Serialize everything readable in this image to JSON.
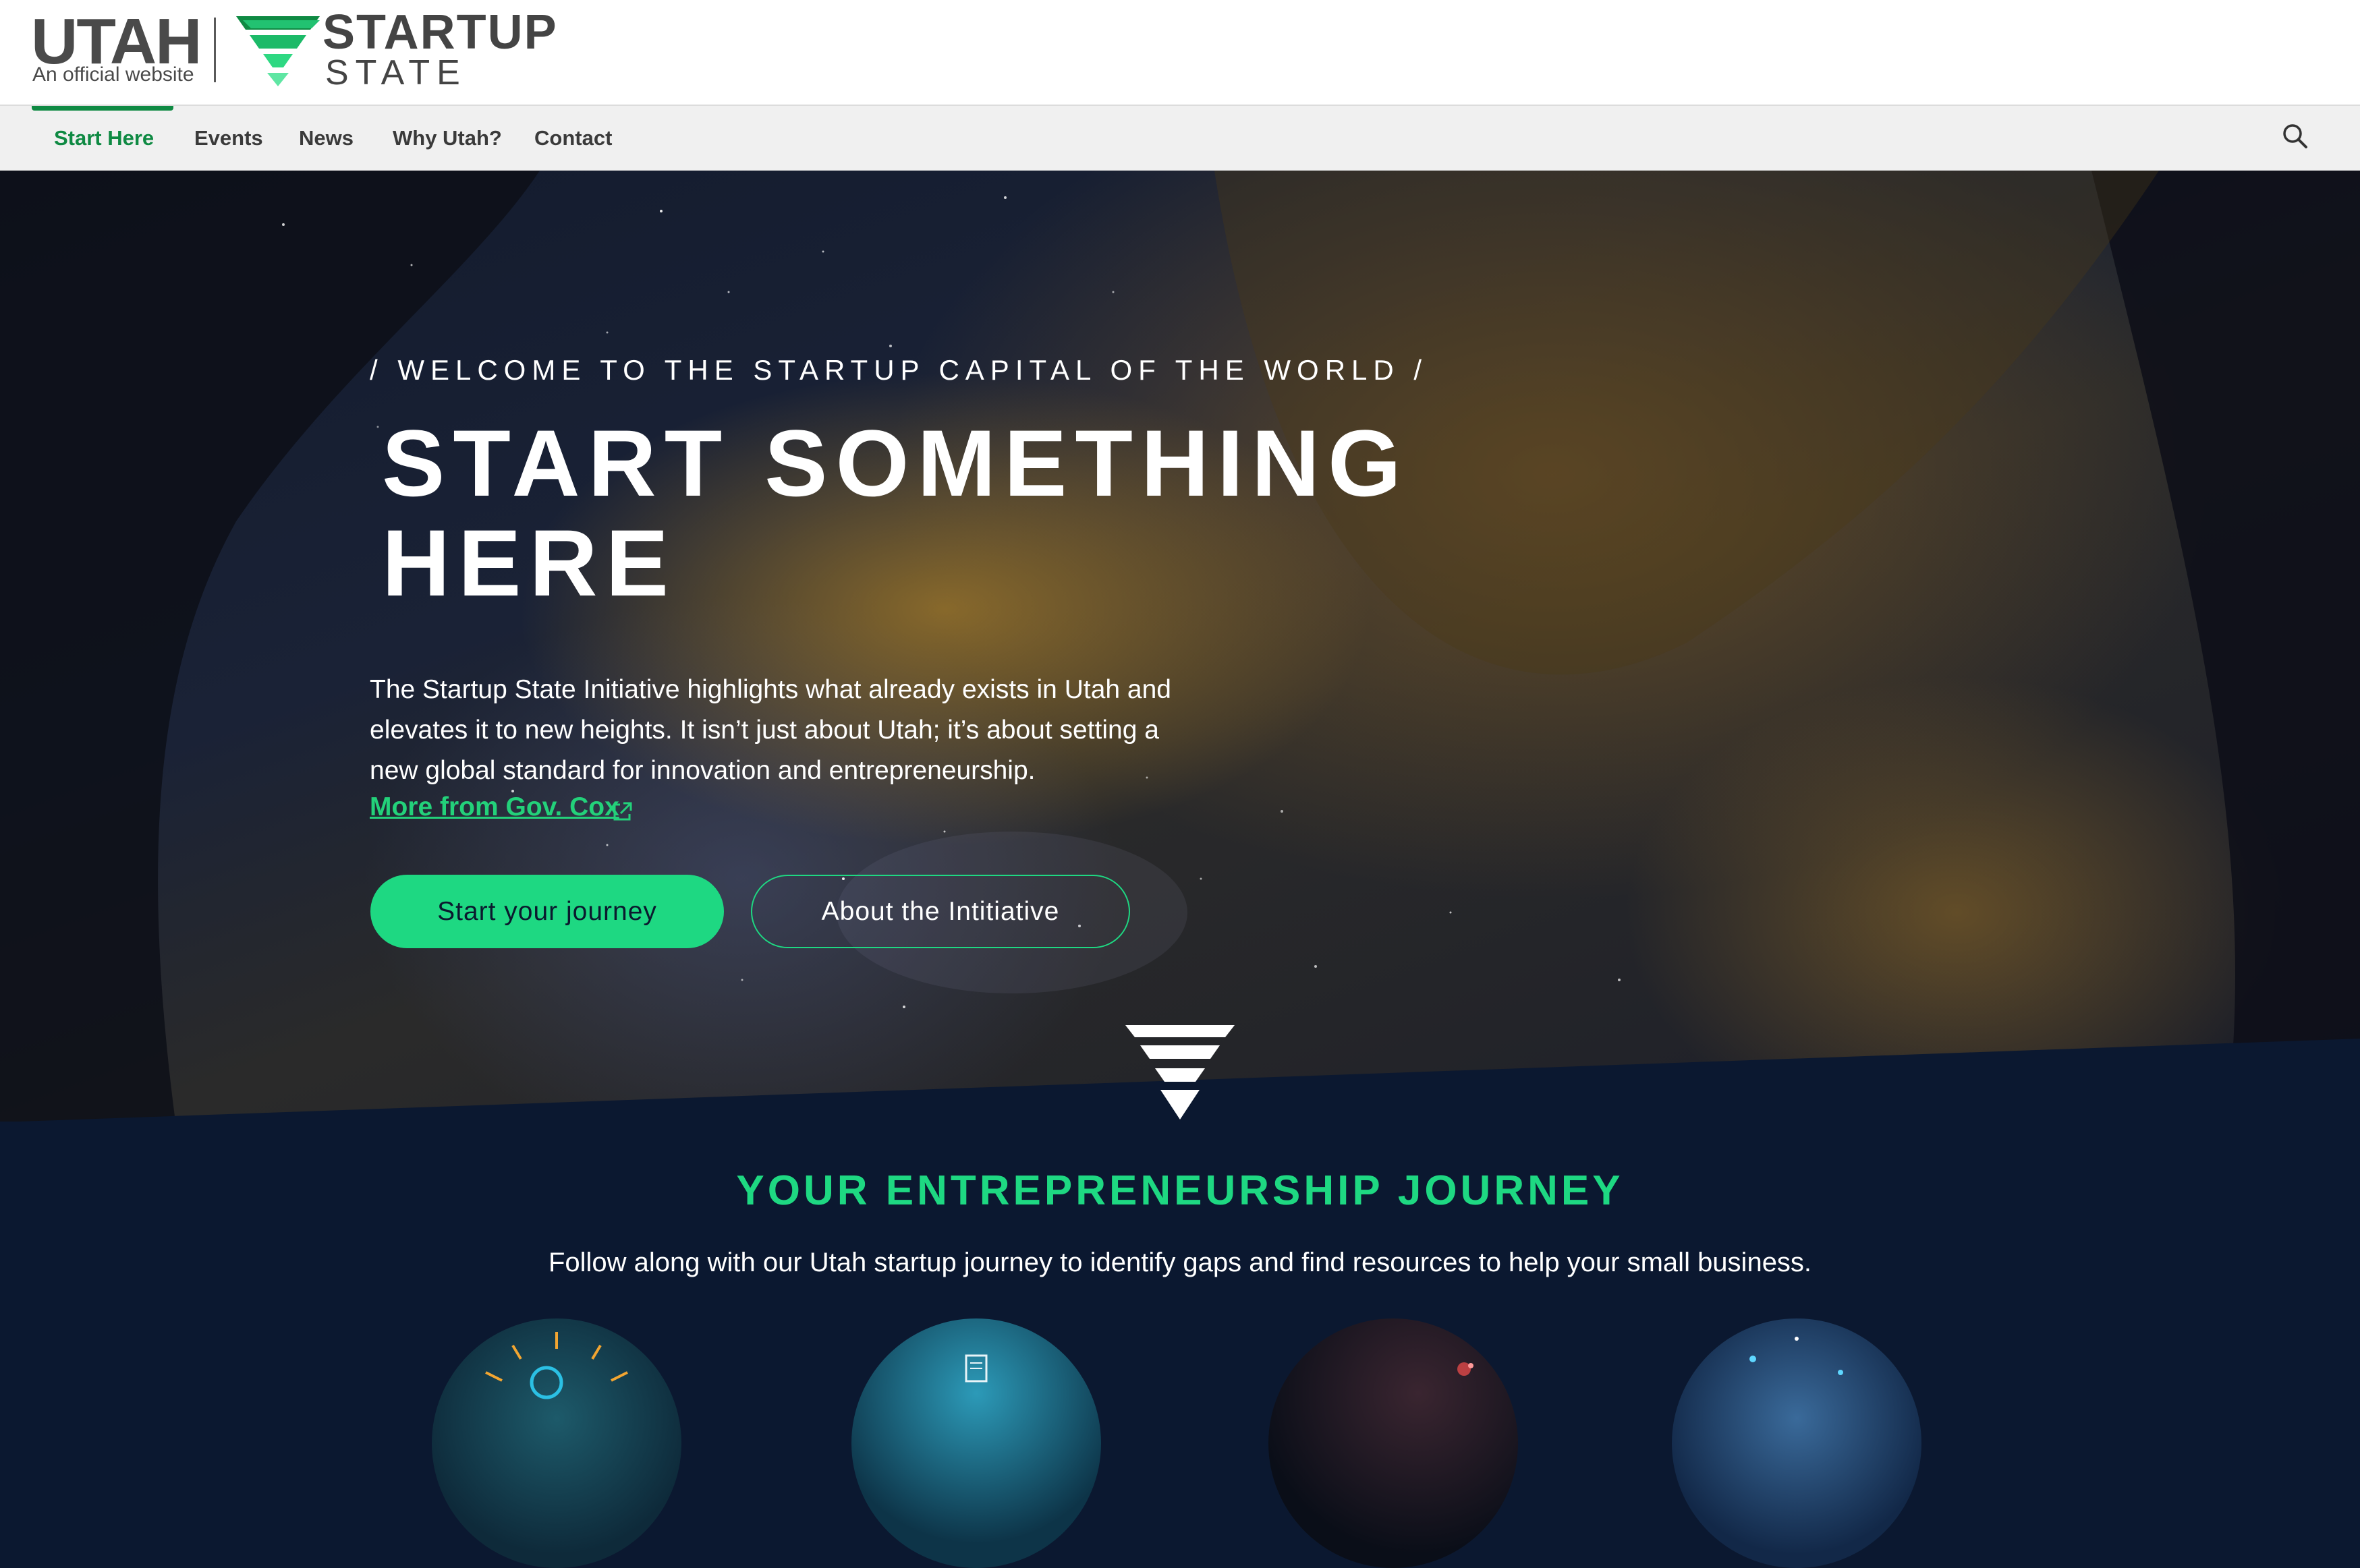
{
  "header": {
    "utah_wordmark": "UTAH",
    "utah_tagline": "An official website",
    "logo_top": "STARTUP",
    "logo_bottom": "STATE"
  },
  "nav": {
    "items": [
      {
        "label": "Start Here",
        "active": true
      },
      {
        "label": "Events",
        "active": false
      },
      {
        "label": "News",
        "active": false
      },
      {
        "label": "Why Utah?",
        "active": false
      },
      {
        "label": "Contact",
        "active": false
      }
    ],
    "search_icon": "search-icon"
  },
  "hero": {
    "eyebrow": "/ WELCOME TO THE STARTUP CAPITAL OF THE WORLD /",
    "title_line1": "START SOMETHING",
    "title_line2": "HERE",
    "body": "The Startup State Initiative highlights what already exists in Utah and elevates it to new heights. It isn’t just about Utah; it’s about setting a new global standard for innovation and entrepreneurship.",
    "link_text": "More from Gov. Cox",
    "link_icon": "external-link-icon",
    "primary_button": "Start your journey",
    "secondary_button": "About the Intitiative"
  },
  "journey": {
    "title": "YOUR ENTREPRENEURSHIP JOURNEY",
    "subtitle": "Follow along with our Utah startup journey to identify gaps and find resources to help your small business."
  },
  "colors": {
    "brand_green": "#1ed882",
    "nav_active": "#0f8a43",
    "navy": "#0b1830"
  }
}
